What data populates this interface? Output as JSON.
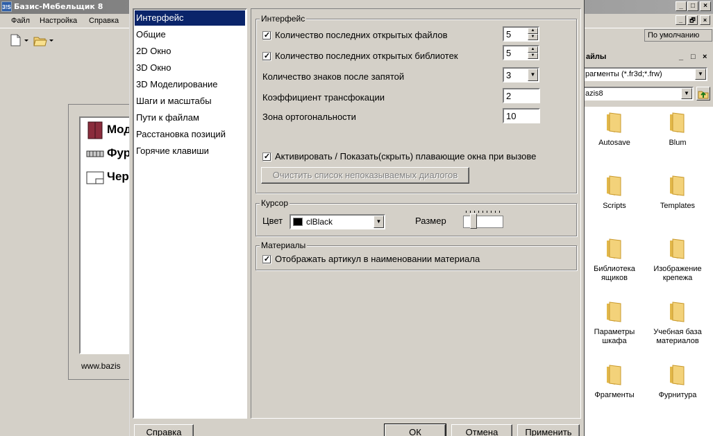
{
  "app": {
    "logo_text": "3!S",
    "title": "Базис-Мебельщик 8",
    "win_buttons": [
      "_",
      "□",
      "×"
    ],
    "mdi_buttons": [
      "_",
      "🗗",
      "×"
    ]
  },
  "menu": [
    "Файл",
    "Настройка",
    "Справка"
  ],
  "preset": "По умолчанию",
  "welcome": {
    "items": [
      "Мод",
      "Фур",
      "Чер"
    ],
    "url": "www.bazis"
  },
  "files_panel": {
    "title": "айлы",
    "head_buttons": [
      "_",
      "□",
      "×"
    ],
    "filter": "рагменты (*.fr3d;*.frw)",
    "path": "azis8",
    "folders": [
      "Autosave",
      "Blum",
      "Scripts",
      "Templates",
      "Библиотека ящиков",
      "Изображение крепежа",
      "Параметры шкафа",
      "Учебная база материалов",
      "Фрагменты",
      "Фурнитура"
    ]
  },
  "dialog": {
    "nav": [
      "Интерфейс",
      "Общие",
      "2D Окно",
      "3D Окно",
      "3D Моделирование",
      "Шаги и масштабы",
      "Пути к файлам",
      "Расстановка позиций",
      "Горячие клавиши"
    ],
    "interface": {
      "legend": "Интерфейс",
      "recent_files_label": "Количество последних открытых файлов",
      "recent_files_value": "5",
      "recent_libs_label": "Количество последних открытых библиотек",
      "recent_libs_value": "5",
      "decimals_label": "Количество знаков после запятой",
      "decimals_value": "3",
      "zoom_label": "Коэффициент трансфокации",
      "zoom_value": "2",
      "ortho_label": "Зона ортогональности",
      "ortho_value": "10",
      "activate_label": "Активировать / Показать(скрыть) плавающие окна при вызове",
      "clear_button": "Очистить список непоказываемых диалогов"
    },
    "cursor": {
      "legend": "Курсор",
      "color_label": "Цвет",
      "color_value": "clBlack",
      "size_label": "Размер",
      "size_level": 0.2
    },
    "materials": {
      "legend": "Материалы",
      "article_label": "Отображать артикул в наименовании материала"
    },
    "buttons": {
      "help": "Справка",
      "ok": "ОК",
      "cancel": "Отмена",
      "apply": "Применить"
    },
    "check_mark": "✓"
  },
  "colors": {
    "selection": "#0a246a",
    "face": "#d4d0c8",
    "folder": "#f3d27a"
  }
}
